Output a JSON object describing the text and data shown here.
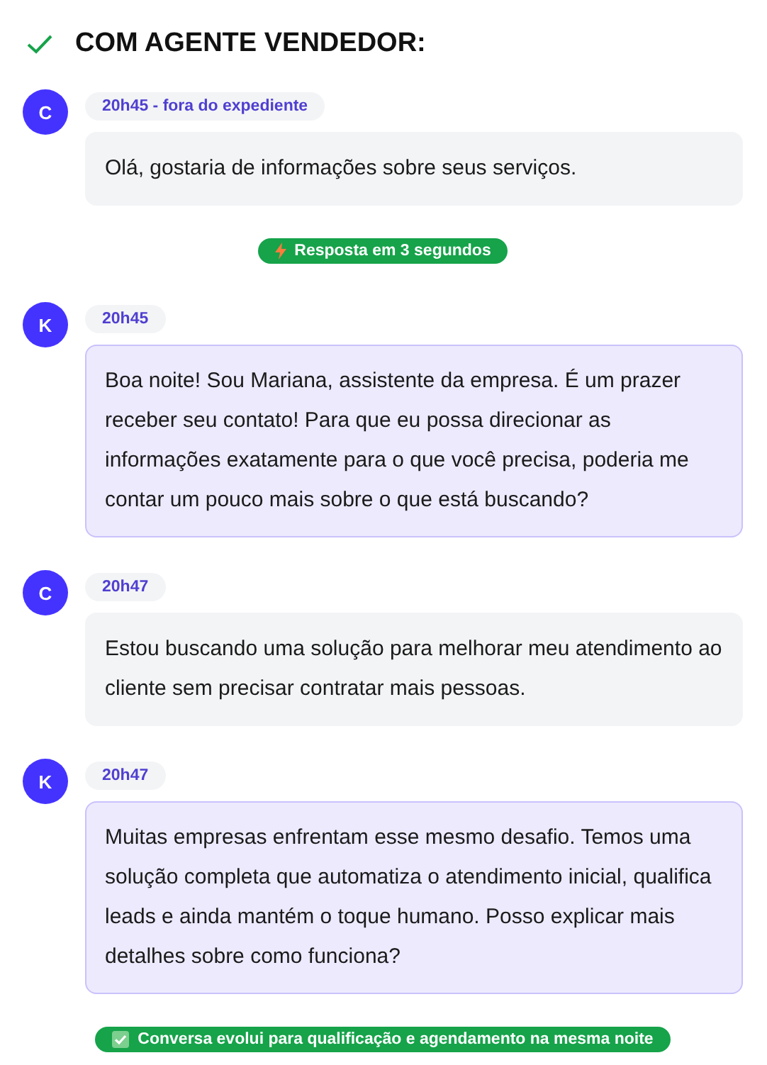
{
  "title": "COM AGENTE VENDEDOR:",
  "items": [
    {
      "kind": "client",
      "avatar": "C",
      "time": "20h45 - fora do expediente",
      "text": "Olá, gostaria de informações sobre seus serviços."
    },
    {
      "kind": "response",
      "text": "Resposta em 3 segundos"
    },
    {
      "kind": "agent",
      "avatar": "K",
      "time": "20h45",
      "text": "Boa noite! Sou Mariana, assistente da empresa. É um prazer receber seu contato! Para que eu possa direcionar as informações exatamente para o que você precisa, poderia me contar um pouco mais sobre o que está buscando?"
    },
    {
      "kind": "client",
      "avatar": "C",
      "time": "20h47",
      "text": "Estou buscando uma solução para melhorar meu atendimento ao cliente sem precisar contratar mais pessoas."
    },
    {
      "kind": "agent",
      "avatar": "K",
      "time": "20h47",
      "text": "Muitas empresas enfrentam esse mesmo desafio. Temos uma solução completa que automatiza o atendimento inicial, qualifica leads e ainda mantém o toque humano. Posso explicar mais detalhes sobre como funciona?"
    },
    {
      "kind": "outcome",
      "text": "Conversa evolui para qualificação e agendamento na mesma noite"
    }
  ]
}
